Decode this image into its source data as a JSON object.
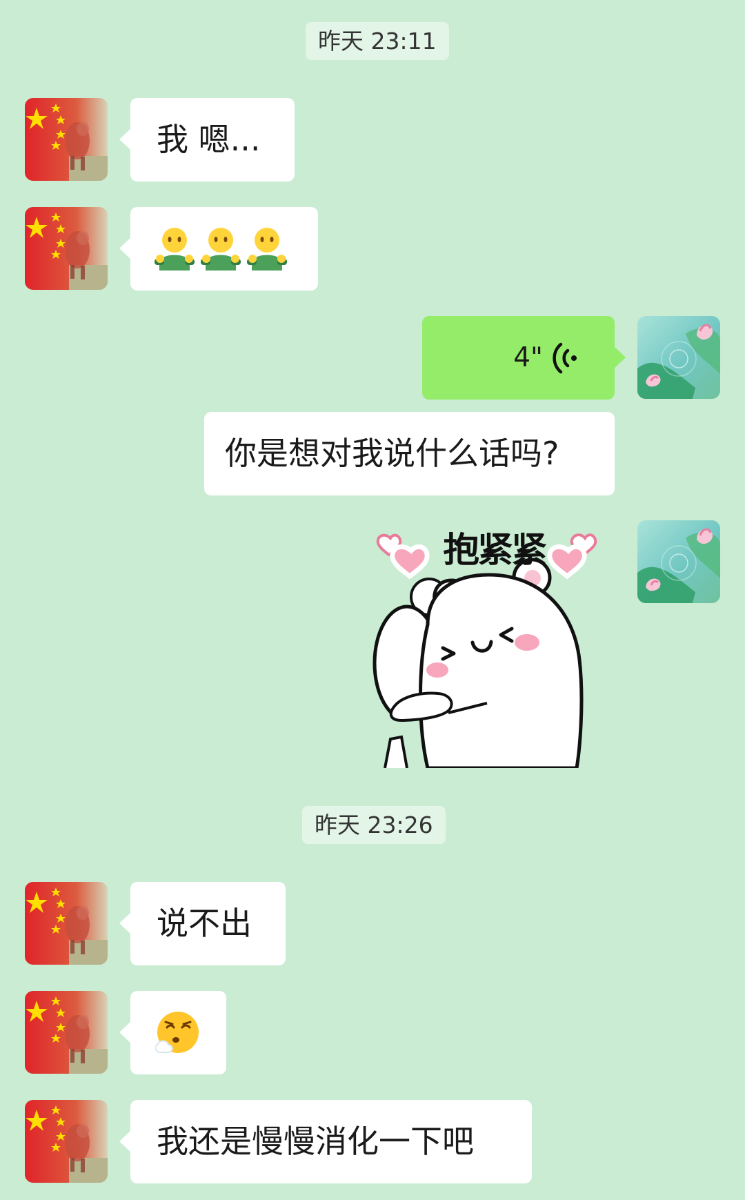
{
  "timestamps": [
    {
      "text": "昨天 23:11"
    },
    {
      "text": "昨天 23:26"
    }
  ],
  "colors": {
    "background": "#c9ecd3",
    "timestamp_background": "#e2f5e7",
    "incoming_bubble": "#ffffff",
    "outgoing_voice_bubble": "#95ec69"
  },
  "messages": [
    {
      "side": "left",
      "type": "text",
      "text": "我 嗯..."
    },
    {
      "side": "left",
      "type": "emoji",
      "emoji_names": [
        "shrug-green-emoji",
        "shrug-green-emoji",
        "shrug-green-emoji"
      ]
    },
    {
      "side": "right",
      "type": "voice",
      "duration": "4\""
    },
    {
      "side": "right",
      "type": "text",
      "text": "你是想对我说什么话吗?"
    },
    {
      "side": "right",
      "type": "sticker",
      "sticker_text": "抱紧紧",
      "sticker_name": "hug-bear-sticker"
    },
    {
      "side": "left",
      "type": "text",
      "text": "说不出"
    },
    {
      "side": "left",
      "type": "emoji",
      "emoji_names": [
        "sighing-face-emoji"
      ]
    },
    {
      "side": "left",
      "type": "text",
      "text": "我还是慢慢消化一下吧"
    }
  ],
  "avatars": {
    "contact": "flag-running-animal-avatar",
    "self": "lotus-pond-avatar"
  }
}
